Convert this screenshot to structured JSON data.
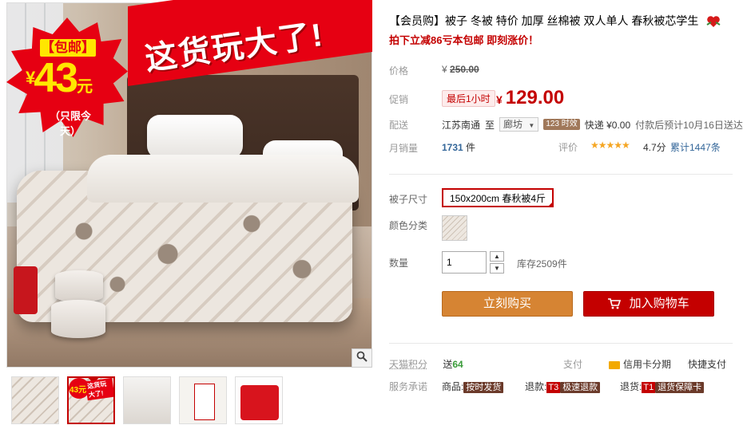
{
  "gallery": {
    "burst": {
      "top_label": "【包邮】",
      "currency": "¥",
      "price": "43",
      "unit": "元",
      "bottom_label": "（只限今天）"
    },
    "banner_text": "这货玩大了!",
    "zoom_icon": "magnifier-icon",
    "thumbnails": [
      {
        "name": "thumb-1"
      },
      {
        "name": "thumb-2",
        "mini_price": "43元",
        "mini_banner": "这货玩大了!"
      },
      {
        "name": "thumb-3"
      },
      {
        "name": "thumb-4"
      },
      {
        "name": "thumb-5"
      }
    ]
  },
  "product": {
    "title": "【会员购】被子 冬被 特价 加厚 丝棉被 双人单人 春秋被芯学生",
    "promo": "拍下立减86亏本包邮 即刻涨价！"
  },
  "price_block": {
    "original_label": "价格",
    "original_currency": "¥",
    "original_price": "250.00",
    "promo_label": "促销",
    "promo_badge": "最后1小时",
    "currency": "¥",
    "price": "129.00"
  },
  "shipping": {
    "label": "配送",
    "from": "江苏南通",
    "to_word": "至",
    "destination": "廊坊",
    "time_badge": "123 时效",
    "express": "快递 ¥0.00",
    "eta": "付款后预计10月16日送达"
  },
  "sales": {
    "label": "月销量",
    "count": "1731",
    "unit": "件",
    "rating_label": "评价",
    "stars": "★★★★★",
    "score": "4.7分",
    "reviews": "累计1447条"
  },
  "options": {
    "size_label": "被子尺寸",
    "size_selected": "150x200cm 春秋被4斤",
    "color_label": "颜色分类",
    "qty_label": "数量",
    "qty_value": "1",
    "stock": "库存2509件"
  },
  "actions": {
    "buy_now": "立刻购买",
    "add_cart": "加入购物车"
  },
  "extras": {
    "points_label": "天猫积分",
    "points_prefix": "送",
    "points_value": "64",
    "pay_label": "支付",
    "credit": "信用卡分期",
    "quick_pay": "快捷支付",
    "promise_label": "服务承诺",
    "goods_label": "商品:",
    "goods_tag": "按时发货",
    "refund_label": "退款:",
    "refund_prefix": "T3",
    "refund_tag": "极速退款",
    "return_label": "退货:",
    "return_prefix": "T1",
    "return_tag": "退货保障卡"
  },
  "colors": {
    "accent_red": "#c40000",
    "buy_orange": "#d68433",
    "link_blue": "#336699"
  }
}
